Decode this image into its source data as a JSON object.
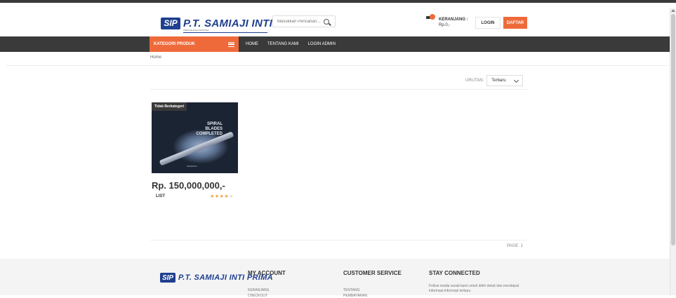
{
  "header": {
    "logo_mark": "SIP",
    "logo_text": "P.T. SAMIAJI INTI PRIMA",
    "logo_subtitle": "PERUSAHAAN NASIONAL",
    "search_placeholder": "Masukkan Pencarian...",
    "cart_label": "KERANJANG :",
    "cart_total": "Rp.0,-",
    "login_label": "LOGIN",
    "register_label": "DAFTAR"
  },
  "nav": {
    "category_label": "KATEGORI PRODUK",
    "links": [
      "HOME",
      "TENTANG KAMI",
      "LOGIN ADMIN"
    ]
  },
  "breadcrumb": "Home",
  "sort": {
    "label": "URUTAN:",
    "selected": "Terbaru"
  },
  "product": {
    "category_badge": "Tidak Berkategori",
    "image_text": [
      "SPIRAL",
      "BLADES",
      "COMPLETED"
    ],
    "image_brand": "KOMATSU",
    "price": "Rp. 150,000,000,-",
    "list_label": "LIST",
    "rating": 4,
    "rating_max": 5
  },
  "pagination": {
    "text": "PAGE: 1"
  },
  "footer": {
    "logo_mark": "SIP",
    "logo_text": "P.T. SAMIAJI INTI PRIMA",
    "my_account": {
      "title": "MY ACCOUNT",
      "items": [
        "KERANJANG",
        "CHECKOUT"
      ]
    },
    "customer_service": {
      "title": "CUSTOMER SERVICE",
      "items": [
        "TENTANG",
        "PEMBAYARAN"
      ]
    },
    "stay_connected": {
      "title": "STAY CONNECTED",
      "text": "Follow media sosial kami untuk lebih dekat dan mendapat informasi-informasi terbaru"
    }
  },
  "colors": {
    "accent": "#ef6a3b",
    "nav_bg": "#3a3a3a",
    "brand_blue": "#1f3f8f"
  }
}
